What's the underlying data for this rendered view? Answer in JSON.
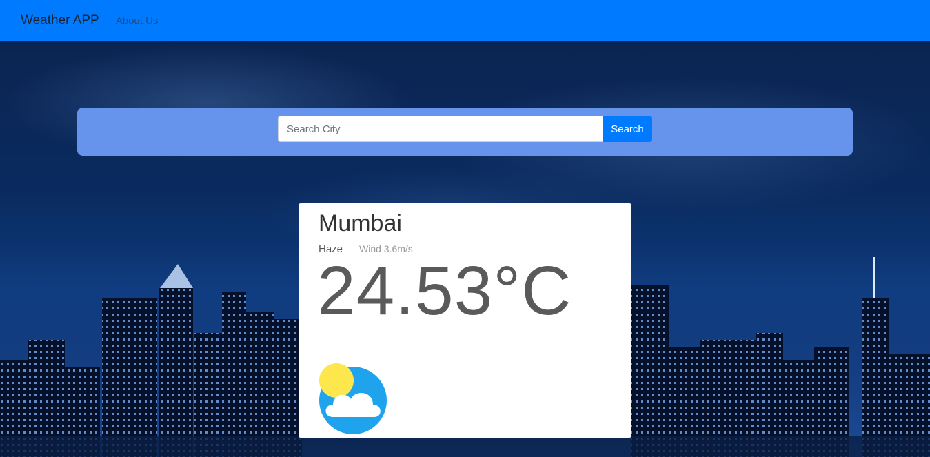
{
  "navbar": {
    "brand": "Weather APP",
    "links": [
      {
        "label": "About Us"
      }
    ]
  },
  "search": {
    "placeholder": "Search City",
    "value": "",
    "button_label": "Search"
  },
  "weather": {
    "city": "Mumbai",
    "condition": "Haze",
    "wind": "Wind 3.6m/s",
    "temperature": "24.53°C",
    "icon": "partly-cloudy-icon"
  },
  "colors": {
    "navbar": "#007bff",
    "search_panel": "#6693eb",
    "button": "#007bff",
    "card": "#ffffff"
  }
}
